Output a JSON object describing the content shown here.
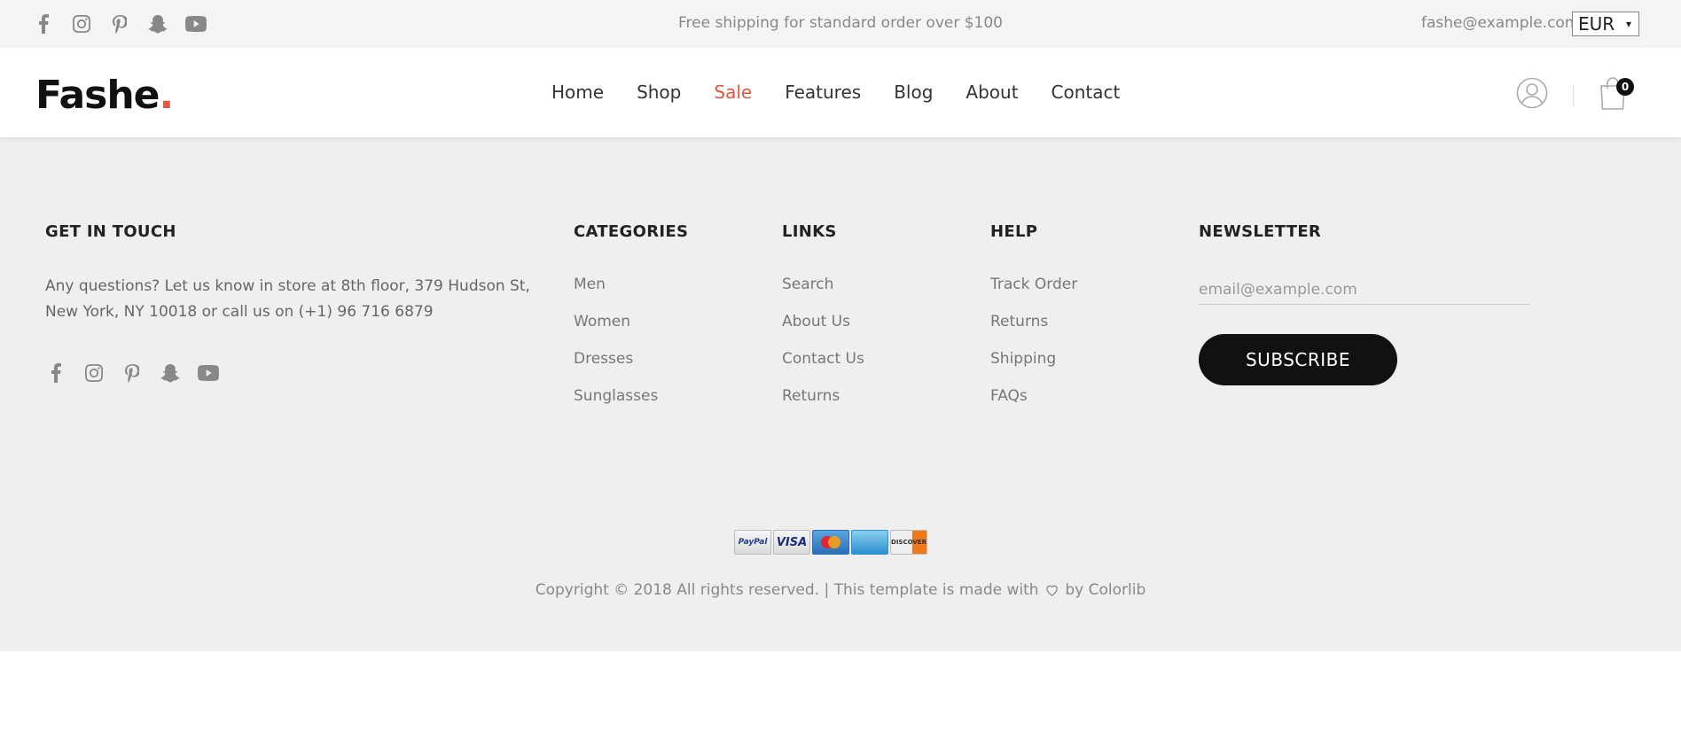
{
  "topbar": {
    "socials": [
      "facebook-icon",
      "instagram-icon",
      "pinterest-icon",
      "snapchat-icon",
      "youtube-icon"
    ],
    "shipping_text": "Free shipping for standard order over $100",
    "email": "fashe@example.com",
    "currency": "EUR"
  },
  "header": {
    "logo": "Fashe",
    "logo_dot": ".",
    "nav": [
      "Home",
      "Shop",
      "Sale",
      "Features",
      "Blog",
      "About",
      "Contact"
    ],
    "active_nav": "Sale",
    "cart_count": "0"
  },
  "footer": {
    "get_in_touch": {
      "title": "GET IN TOUCH",
      "text": "Any questions? Let us know in store at 8th floor, 379 Hudson St, New York, NY 10018 or call us on (+1) 96 716 6879"
    },
    "categories": {
      "title": "CATEGORIES",
      "items": [
        "Men",
        "Women",
        "Dresses",
        "Sunglasses"
      ]
    },
    "links": {
      "title": "LINKS",
      "items": [
        "Search",
        "About Us",
        "Contact Us",
        "Returns"
      ]
    },
    "help": {
      "title": "HELP",
      "items": [
        "Track Order",
        "Returns",
        "Shipping",
        "FAQs"
      ]
    },
    "newsletter": {
      "title": "NEWSLETTER",
      "placeholder": "email@example.com",
      "button": "SUBSCRIBE"
    },
    "payments": [
      "PayPal",
      "VISA",
      "MasterCard",
      "American Express",
      "DISCOVER"
    ],
    "copyright_before": "Copyright © 2018 All rights reserved. | This template is made with",
    "copyright_after": "by Colorlib"
  },
  "colors": {
    "accent": "#e65540",
    "topbar_bg": "#f4f4f4",
    "footer_bg": "#efefef",
    "button_bg": "#111111"
  }
}
